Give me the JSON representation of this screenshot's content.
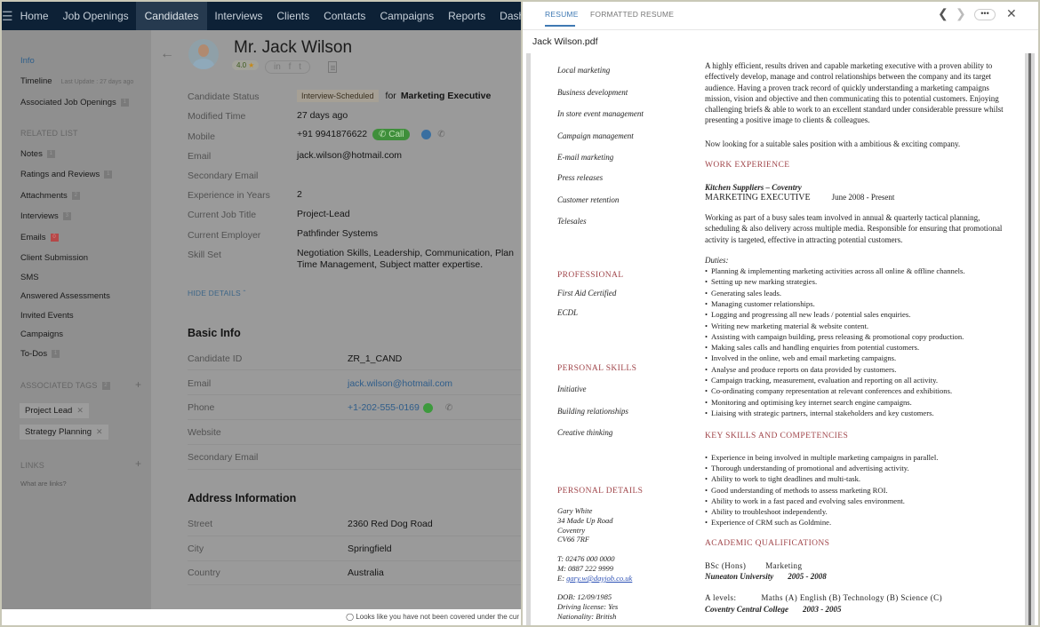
{
  "app": {
    "nav": {
      "menu_icon": "hamburger-icon",
      "items": [
        "Home",
        "Job Openings",
        "Candidates",
        "Interviews",
        "Clients",
        "Contacts",
        "Campaigns",
        "Reports",
        "Dashbo"
      ],
      "active": "Candidates"
    },
    "sidebar": {
      "info": "Info",
      "timeline": "Timeline",
      "timeline_sub": "Last Update : 27 days ago",
      "associated_jobs": "Associated Job Openings",
      "associated_jobs_count": "1",
      "related_list_heading": "RELATED LIST",
      "related": [
        {
          "label": "Notes",
          "count": "1"
        },
        {
          "label": "Ratings and Reviews",
          "count": "1"
        },
        {
          "label": "Attachments",
          "count": "2"
        },
        {
          "label": "Interviews",
          "count": "3"
        },
        {
          "label": "Emails",
          "count": "0"
        },
        {
          "label": "Client Submission",
          "count": ""
        },
        {
          "label": "SMS",
          "count": ""
        },
        {
          "label": "Answered Assessments",
          "count": ""
        },
        {
          "label": "Invited Events",
          "count": ""
        },
        {
          "label": "Campaigns",
          "count": ""
        },
        {
          "label": "To-Dos",
          "count": "1"
        }
      ],
      "tags_heading": "ASSOCIATED TAGS",
      "tags_count": "2",
      "tags": [
        "Project Lead",
        "Strategy Planning"
      ],
      "links_heading": "LINKS",
      "links_help": "What are links?"
    },
    "candidate": {
      "name": "Mr. Jack Wilson",
      "rating": "4.0",
      "social": [
        "in",
        "f",
        "t"
      ],
      "fields": {
        "status_label": "Candidate Status",
        "status_value": "Interview-Scheduled",
        "status_for": "for",
        "status_job": "Marketing Executive",
        "modified_label": "Modified Time",
        "modified_value": "27 days ago",
        "mobile_label": "Mobile",
        "mobile_value": "+91 9941876622",
        "call_label": "Call",
        "email_label": "Email",
        "email_value": "jack.wilson@hotmail.com",
        "sec_email_label": "Secondary Email",
        "exp_label": "Experience in Years",
        "exp_value": "2",
        "job_title_label": "Current Job Title",
        "job_title_value": "Project-Lead",
        "employer_label": "Current Employer",
        "employer_value": "Pathfinder Systems",
        "skills_label": "Skill Set",
        "skills_line1": "Negotiation Skills, Leadership, Communication, Plan",
        "skills_line2": "Time Management, Subject matter expertise."
      },
      "hide_details": "HIDE DETAILS"
    },
    "basic_info": {
      "title": "Basic Info",
      "rows": [
        {
          "label": "Candidate ID",
          "value": "ZR_1_CAND"
        },
        {
          "label": "Email",
          "value": "jack.wilson@hotmail.com"
        },
        {
          "label": "Phone",
          "value": "+1-202-555-0169"
        },
        {
          "label": "Website",
          "value": ""
        },
        {
          "label": "Secondary Email",
          "value": ""
        }
      ]
    },
    "address": {
      "title": "Address Information",
      "rows": [
        {
          "label": "Street",
          "value": "2360 Red Dog Road"
        },
        {
          "label": "City",
          "value": "Springfield"
        },
        {
          "label": "Country",
          "value": "Australia"
        }
      ]
    },
    "footer_notice": "Looks like you have not been covered under the cur"
  },
  "panel": {
    "tabs": [
      "RESUME",
      "FORMATTED RESUME"
    ],
    "active_tab": "RESUME",
    "file_name": "Jack Wilson.pdf",
    "resume": {
      "left_skills": [
        "Local marketing",
        "Business development",
        "In store event management",
        "Campaign management",
        "E-mail marketing",
        "Press releases",
        "Customer retention",
        "Telesales"
      ],
      "professional_heading": "PROFESSIONAL",
      "professional": [
        "First Aid Certified",
        "ECDL"
      ],
      "personal_skills_heading": "PERSONAL SKILLS",
      "personal_skills": [
        "Initiative",
        "Building relationships",
        "Creative thinking"
      ],
      "personal_details_heading": "PERSONAL DETAILS",
      "address_lines": [
        "Gary White",
        "34 Made Up Road",
        "Coventry",
        "CV66 7RF"
      ],
      "phone_t": "T: 02476 000 0000",
      "phone_m": "M: 0887 222 9999",
      "email_prefix": "E:",
      "email": "gary.w@dayjob.co.uk",
      "dob": "DOB: 12/09/1985",
      "driving": "Driving license:  Yes",
      "nationality": "Nationality: British",
      "summary": "A highly efficient, results driven and capable marketing executive with a proven ability to effectively develop, manage and control relationships between the company and its target audience. Having a proven track record of quickly understanding a marketing campaigns mission, vision and objective and then communicating this to potential customers. Enjoying challenging briefs & able to work to an excellent standard under considerable pressure whilst presenting a positive image to clients & colleagues.",
      "looking": "Now looking for a suitable sales position with a ambitious & exciting company.",
      "work_heading": "WORK EXPERIENCE",
      "employer": "Kitchen Suppliers – Coventry",
      "job_title": "MARKETING EXECUTIVE",
      "job_dates": "June 2008 - Present",
      "job_desc": "Working as part of a busy sales team involved in annual & quarterly tactical planning, scheduling & also delivery across multiple media. Responsible for ensuring that promotional activity is targeted, effective in attracting potential customers.",
      "duties_label": "Duties",
      "duties": [
        "Planning & implementing marketing activities across all online & offline channels.",
        "Setting up new marking strategies.",
        "Generating sales leads.",
        "Managing customer relationships.",
        "Logging and progressing all new leads / potential sales enquiries.",
        "Writing new marketing material & website content.",
        "Assisting with campaign building, press releasing & promotional copy production.",
        "Making sales calls and handling enquiries from potential customers.",
        "Involved in the online, web and email marketing campaigns.",
        "Analyse and produce reports on data provided by customers.",
        "Campaign tracking, measurement, evaluation and reporting on all activity.",
        "Co-ordinating company representation at relevant conferences and exhibitions.",
        "Monitoring and optimising key internet search engine campaigns.",
        "Liaising with strategic partners, internal stakeholders and key customers."
      ],
      "key_skills_heading": "KEY SKILLS AND COMPETENCIES",
      "key_skills": [
        "Experience in being involved in multiple marketing campaigns in parallel.",
        "Thorough understanding of promotional and advertising activity.",
        "Ability to work to tight deadlines and multi-task.",
        "Good understanding of methods to assess marketing ROI.",
        "Ability to work in a fast paced and evolving sales environment.",
        "Ability to troubleshoot independently.",
        "Experience of CRM such as Goldmine."
      ],
      "academic_heading": "ACADEMIC QUALIFICATIONS",
      "degree": "BSc (Hons)",
      "degree_subject": "Marketing",
      "university": "Nuneaton University",
      "university_dates": "2005 - 2008",
      "alevels_label": "A levels:",
      "alevels": "Maths (A) English (B) Technology (B) Science (C)",
      "college": "Coventry Central College",
      "college_dates": "2003 - 2005"
    }
  }
}
